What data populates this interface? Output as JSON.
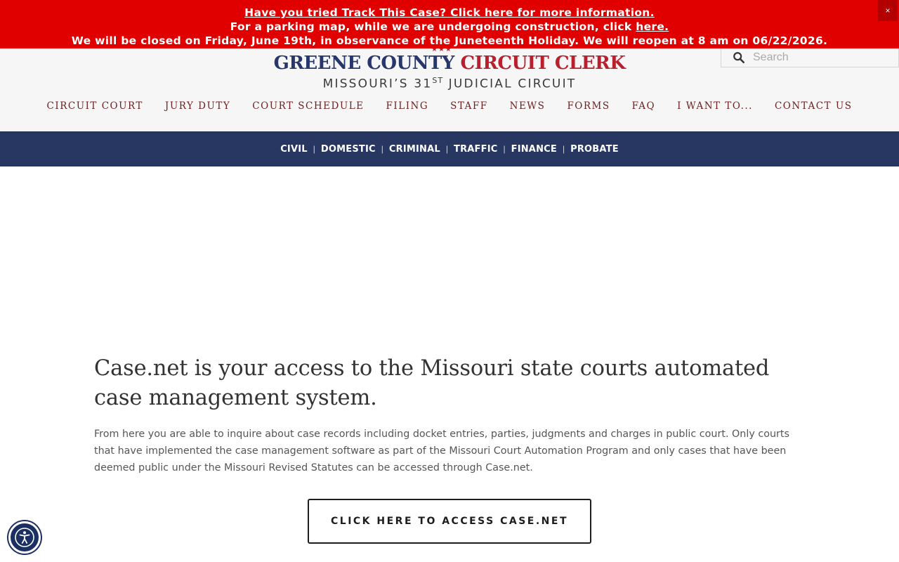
{
  "alert": {
    "line1": "Have you tried Track This Case? Click here for more information.",
    "line2_text": "For a parking map, while we are undergoing construction, click",
    "line2_link": "here.",
    "line3": "We will be closed on Friday, June 19th, in observance of the Juneteenth Holiday. We will reopen at 8 am on 06/22/2026.",
    "close": "×"
  },
  "logo": {
    "stars": "★★★",
    "name_part1": "GREENE COUNTY",
    "name_part2": "CIRCUIT CLERK",
    "sub_part1": "MISSOURI’S 31",
    "sub_sup": "ST",
    "sub_part2": " JUDICIAL CIRCUIT"
  },
  "search": {
    "placeholder": "Search"
  },
  "nav": {
    "items": [
      "CIRCUIT COURT",
      "JURY DUTY",
      "COURT SCHEDULE",
      "FILING",
      "STAFF",
      "NEWS",
      "FORMS",
      "FAQ",
      "I WANT TO...",
      "CONTACT US"
    ]
  },
  "subnav": {
    "items": [
      "CIVIL",
      "DOMESTIC",
      "CRIMINAL",
      "TRAFFIC",
      "FINANCE",
      "PROBATE"
    ],
    "separator": "|"
  },
  "main": {
    "heading": "Case.net is your access to the Missouri state courts automated case management system.",
    "body": "From here you are able to inquire about case records including docket entries, parties, judgments and charges in public court. Only courts that have implemented the case management software as part of the Missouri Court Automation Program and only cases that have been deemed public under the Missouri Revised Statutes can be accessed through Case.net.",
    "cta": "CLICK HERE TO ACCESS CASE.NET"
  },
  "colors": {
    "alert_red": "#e10000",
    "navy": "#283761",
    "logo_blue": "#27366b",
    "logo_red": "#b8202e"
  },
  "icons": {
    "search": "search-icon",
    "close": "close-icon",
    "accessibility": "accessibility-icon"
  }
}
